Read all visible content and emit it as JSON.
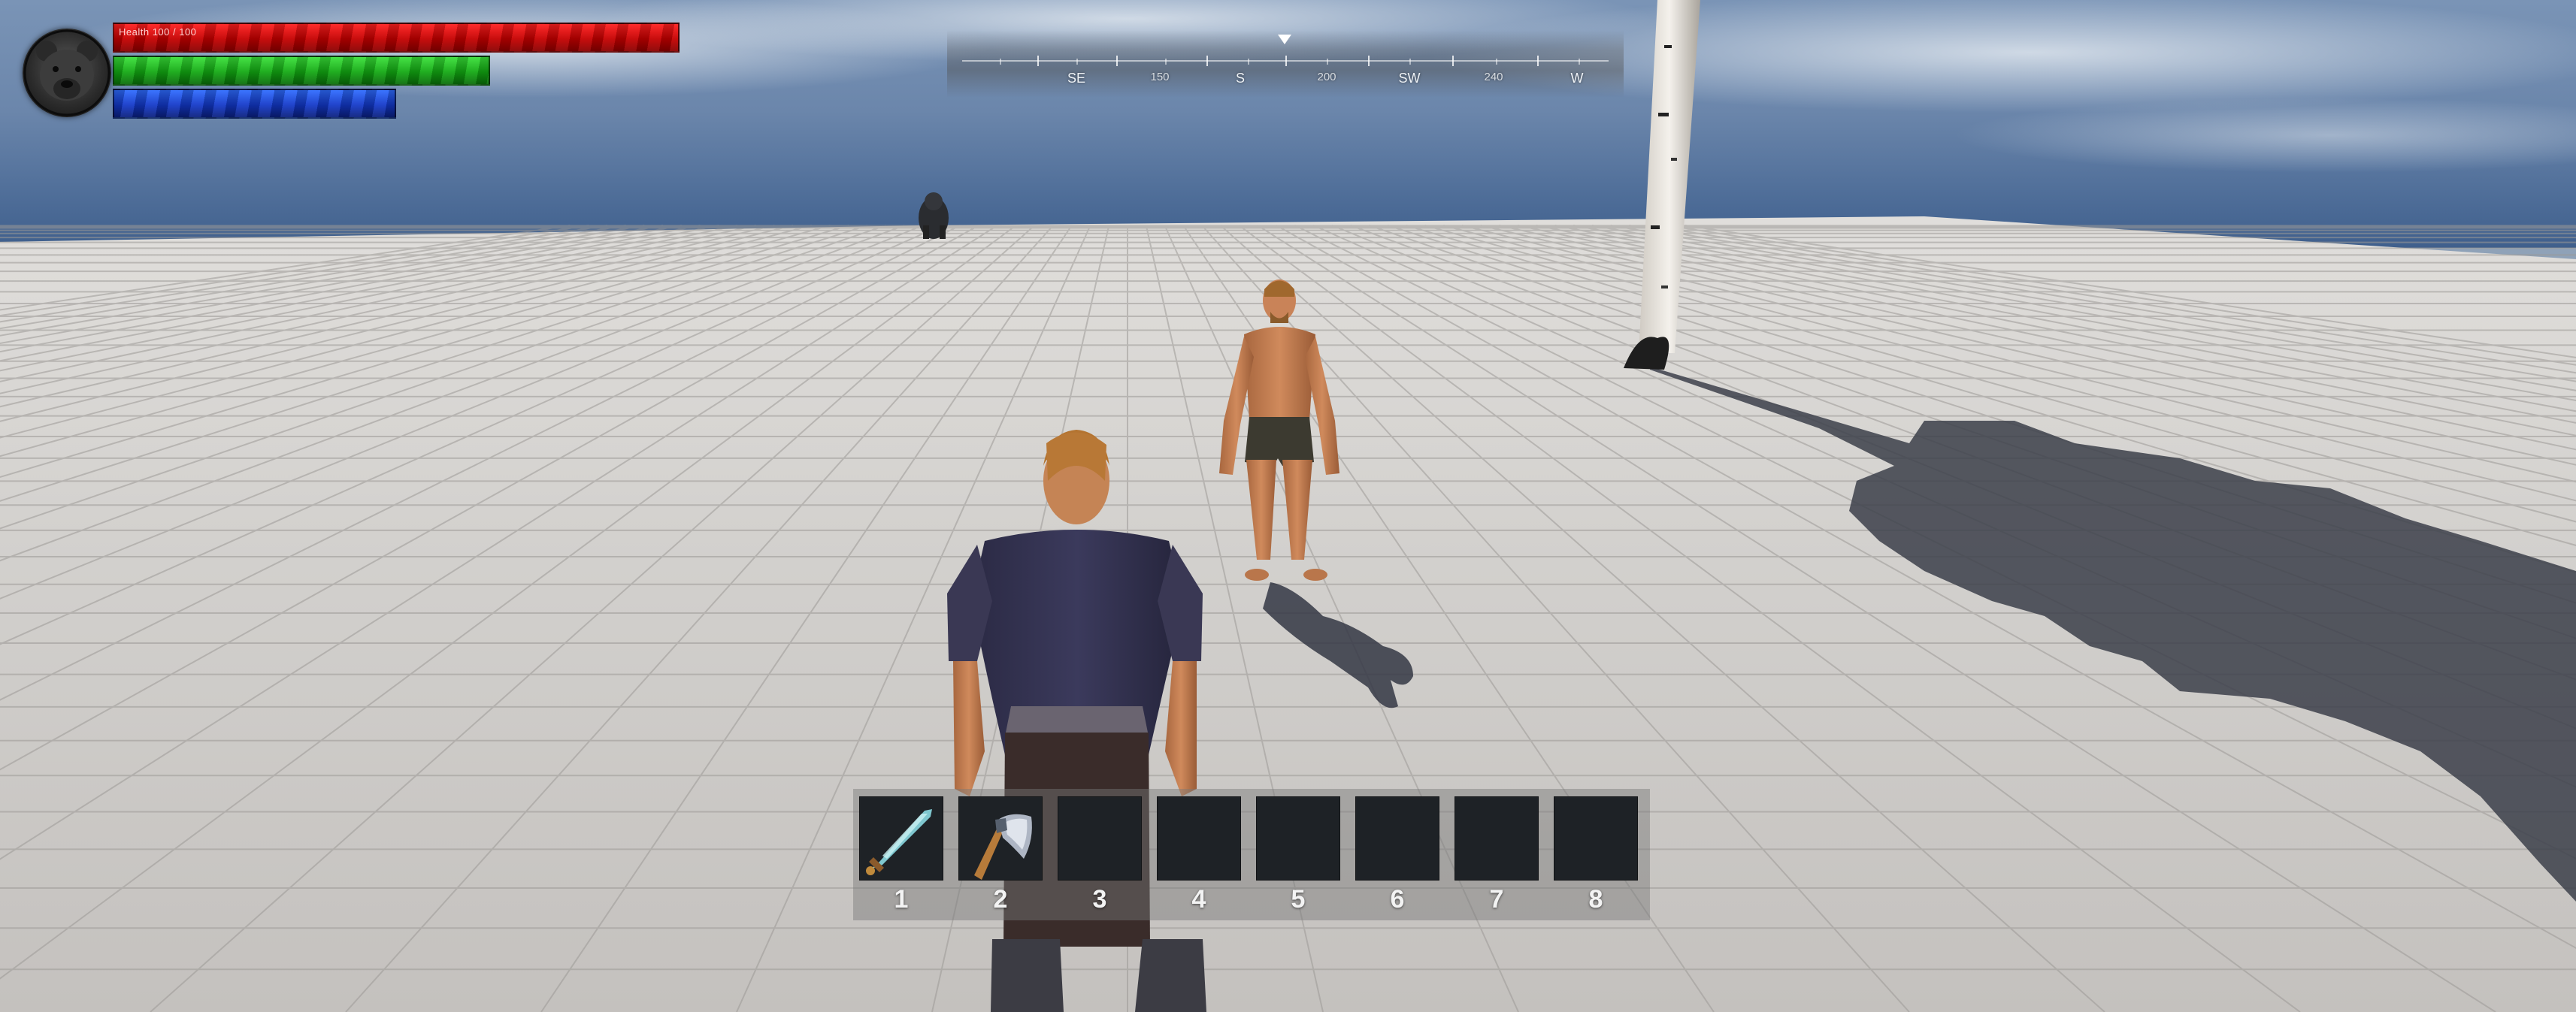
{
  "status": {
    "portrait_icon": "bear-head-icon",
    "health_label": "Health 100 / 100",
    "bars": [
      {
        "name": "health",
        "fill": 1.0,
        "color": "#e01010"
      },
      {
        "name": "stamina",
        "fill": 0.66,
        "color": "#1bb81b"
      },
      {
        "name": "mana",
        "fill": 0.5,
        "color": "#1a46e0"
      }
    ]
  },
  "compass": {
    "headings": [
      "SE",
      "150",
      "S",
      "200",
      "SW",
      "240",
      "W"
    ],
    "marker_icon": "triangle-down-icon"
  },
  "hotbar": {
    "slots": [
      {
        "number": "1",
        "item_icon": "crystal-sword-icon"
      },
      {
        "number": "2",
        "item_icon": "axe-icon"
      },
      {
        "number": "3",
        "item_icon": ""
      },
      {
        "number": "4",
        "item_icon": ""
      },
      {
        "number": "5",
        "item_icon": ""
      },
      {
        "number": "6",
        "item_icon": ""
      },
      {
        "number": "7",
        "item_icon": ""
      },
      {
        "number": "8",
        "item_icon": ""
      }
    ]
  },
  "colors": {
    "sky_top": "#6f8db0",
    "horizon": "#4d6b96",
    "floor_light": "#d6d4d2",
    "floor_dark": "#bdbab7",
    "hotbar_slot": "#1e2226"
  }
}
